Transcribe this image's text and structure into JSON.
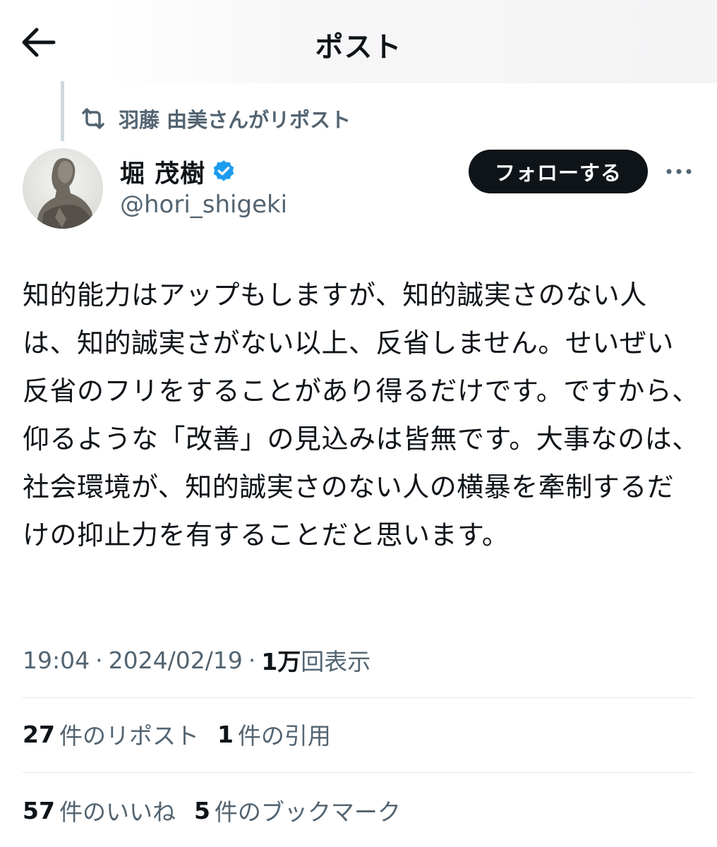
{
  "header": {
    "title": "ポスト"
  },
  "repost_context": {
    "text": "羽藤 由美さんがリポスト"
  },
  "author": {
    "name": "堀 茂樹",
    "handle": "@hori_shigeki",
    "verified": true
  },
  "follow_button": {
    "label": "フォローする"
  },
  "post": {
    "text": "知的能力はアップもしますが、知的誠実さのない人は、知的誠実さがない以上、反省しません。せいぜい反省のフリをすることがあり得るだけです。ですから、仰るような「改善」の見込みは皆無です。大事なのは、社会環境が、知的誠実さのない人の横暴を牽制するだけの抑止力を有することだと思います。",
    "time": "19:04",
    "date": "2024/02/19",
    "views_count": "1万",
    "views_label": "回表示"
  },
  "stats": {
    "reposts_count": "27",
    "reposts_label": "件のリポスト",
    "quotes_count": "1",
    "quotes_label": "件の引用",
    "likes_count": "57",
    "likes_label": "件のいいね",
    "bookmarks_count": "5",
    "bookmarks_label": "件のブックマーク"
  },
  "colors": {
    "text_primary": "#0f1419",
    "text_secondary": "#536471",
    "verified_blue": "#1d9bf0",
    "follow_button_bg": "#0f1419",
    "divider": "#e1e8ed"
  },
  "icons": {
    "back": "arrow-left-icon",
    "repost": "repost-icon",
    "verified": "verified-badge-icon",
    "more": "more-icon"
  }
}
